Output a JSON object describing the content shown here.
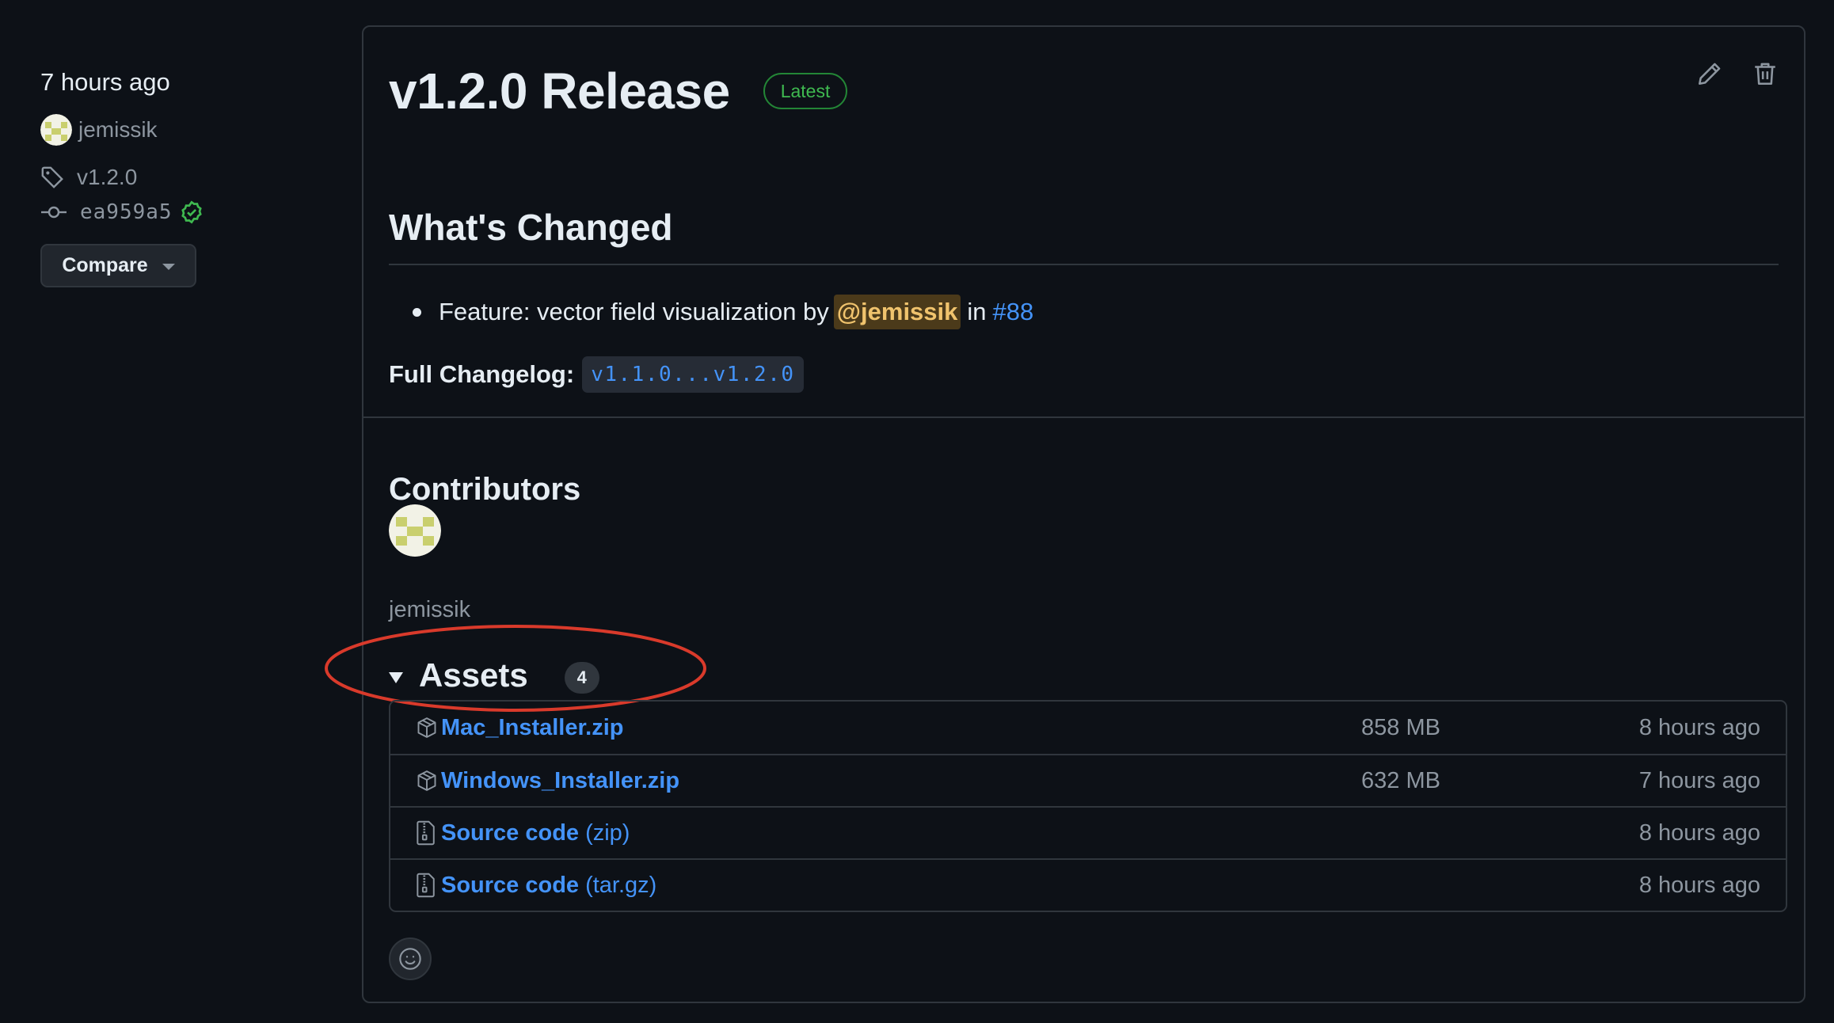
{
  "sidebar": {
    "time": "7 hours ago",
    "author": "jemissik",
    "tag": "v1.2.0",
    "commit": "ea959a5",
    "compare_label": "Compare"
  },
  "release": {
    "title": "v1.2.0 Release",
    "badge": "Latest",
    "whats_changed": "What's Changed",
    "items": [
      {
        "prefix": "Feature: vector field visualization by",
        "mention": "@jemissik",
        "in_label": "in",
        "pr": "#88"
      }
    ],
    "changelog_label": "Full Changelog:",
    "changelog_link": "v1.1.0...v1.2.0"
  },
  "contributors": {
    "title": "Contributors",
    "names": [
      "jemissik"
    ]
  },
  "assets": {
    "title": "Assets",
    "count": "4",
    "rows": [
      {
        "name": "Mac_Installer.zip",
        "suffix": "",
        "size": "858 MB",
        "date": "8 hours ago",
        "icon": "package-icon"
      },
      {
        "name": "Windows_Installer.zip",
        "suffix": "",
        "size": "632 MB",
        "date": "7 hours ago",
        "icon": "package-icon"
      },
      {
        "name": "Source code",
        "suffix": "(zip)",
        "size": "",
        "date": "8 hours ago",
        "icon": "file-zip-icon"
      },
      {
        "name": "Source code",
        "suffix": "(tar.gz)",
        "size": "",
        "date": "8 hours ago",
        "icon": "file-zip-icon"
      }
    ]
  },
  "colors": {
    "background": "#0d1117",
    "border": "#30363d",
    "link": "#4493f8",
    "latest_green": "#3fb950",
    "annotation_red": "#d93a2b",
    "mention_highlight": "#4b3a1a"
  },
  "icons": [
    "tag-icon",
    "git-commit-icon",
    "verified-icon",
    "pencil-icon",
    "trash-icon",
    "package-icon",
    "file-zip-icon",
    "smiley-icon",
    "triangle-down-icon"
  ]
}
